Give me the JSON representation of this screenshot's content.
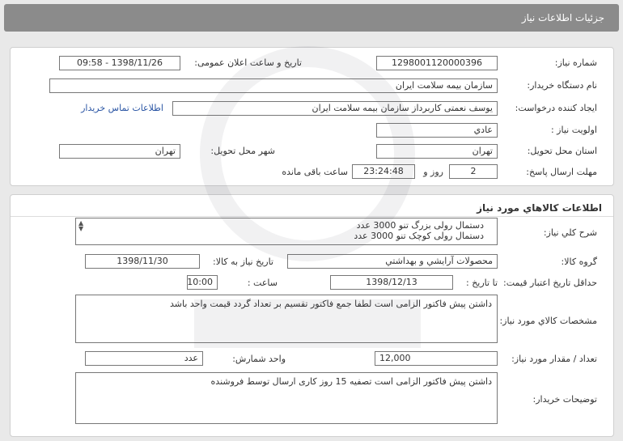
{
  "header": {
    "title": "جزئیات اطلاعات نیاز"
  },
  "need_info": {
    "need_number_label": "شماره نیاز:",
    "need_number": "1298001120000396",
    "announce_label": "تاریخ و ساعت اعلان عمومی:",
    "announce_value": "1398/11/26 - 09:58",
    "buyer_label": "نام دستگاه خریدار:",
    "buyer_value": "سازمان بیمه سلامت ایران",
    "creator_label": "ایجاد کننده درخواست:",
    "creator_value": "یوسف نعمتی کاربرداز سازمان بیمه سلامت ایران",
    "contact_link": "اطلاعات تماس خریدار",
    "priority_label": "اولویت نیاز :",
    "priority_value": "عادي",
    "province_label": "استان محل تحویل:",
    "province_value": "تهران",
    "city_label": "شهر محل تحویل:",
    "city_value": "تهران",
    "deadline_label": "مهلت ارسال پاسخ:",
    "days_value": "2",
    "days_and_label": "روز و",
    "time_value": "23:24:48",
    "remaining_label": "ساعت باقی مانده"
  },
  "goods": {
    "section_title": "اطلاعات کالاهاي مورد نياز",
    "summary_label": "شرح كلي نياز:",
    "summary_line1": "دستمال رولی بزرگ تنو 3000 عدد",
    "summary_line2": "دستمال رولی کوچک تنو 3000 عدد",
    "group_label": "گروه کالا:",
    "group_value": "محصولات آرايشي و بهداشتي",
    "need_date_label": "تاريخ نياز به کالا:",
    "need_date_value": "1398/11/30",
    "min_validity_label": "حداقل تاريخ اعتبار قيمت:",
    "until_date_label": "تا تاريخ :",
    "until_date_value": "1398/12/13",
    "hour_label": "ساعت :",
    "hour_value": "10:00",
    "spec_label": "مشخصات کالاي مورد نياز:",
    "spec_value": "داشتن پیش فاکتور الزامی است لطفا جمع فاکتور تقسیم بر تعداد گردد قیمت واحد باشد",
    "qty_label": "تعداد / مقدار مورد نياز:",
    "qty_value": "12,000",
    "unit_label": "واحد شمارش:",
    "unit_value": "عدد",
    "buyer_notes_label": "توضيحات خريدار:",
    "buyer_notes_value": "داشتن پیش فاکتور الزامی است تصفیه 15 روز کاری ارسال توسط فروشنده"
  },
  "colors": {
    "header_bg": "#8b8b8b",
    "link": "#2a55a4"
  }
}
